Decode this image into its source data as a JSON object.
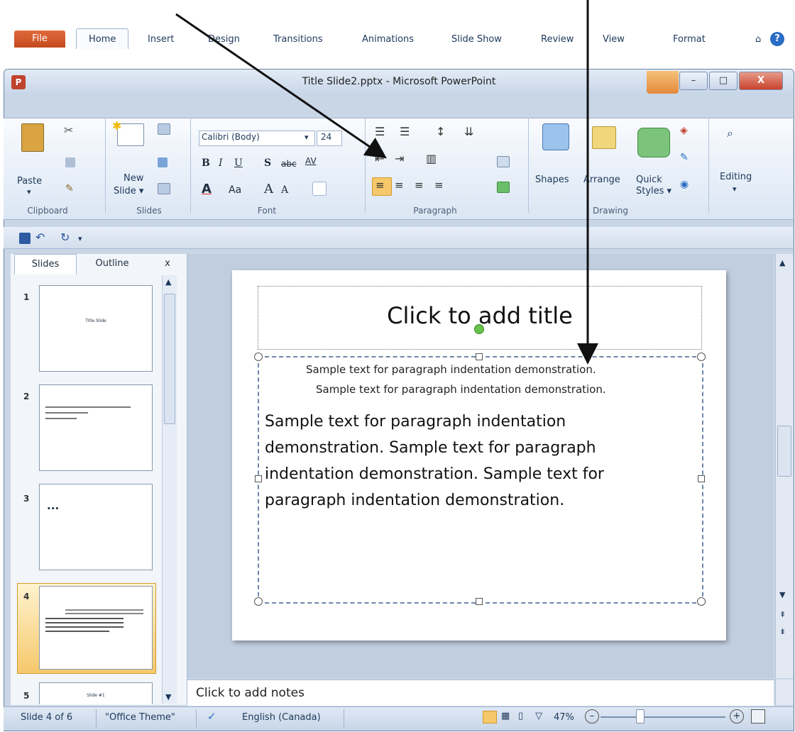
{
  "window": {
    "title": "Title Slide2.pptx - Microsoft PowerPoint",
    "app_icon": "P",
    "controls": {
      "minimize": "–",
      "maximize": "□",
      "close": "X"
    }
  },
  "tabs": [
    "File",
    "Home",
    "Insert",
    "Design",
    "Transitions",
    "Animations",
    "Slide Show",
    "Review",
    "View",
    "Format"
  ],
  "ribbon": {
    "clipboard": {
      "paste": "Paste",
      "label": "Clipboard"
    },
    "slides": {
      "new_slide": "New",
      "new_slide2": "Slide ▾",
      "label": "Slides"
    },
    "font": {
      "name": "Calibri (Body)",
      "size": "24",
      "bold": "B",
      "italic": "I",
      "underline": "U",
      "shadow": "S",
      "strike": "abc",
      "spacing": "AV",
      "font_color": "A",
      "case": "Aa",
      "grow": "A",
      "shrink": "A",
      "label": "Font"
    },
    "paragraph": {
      "label": "Paragraph"
    },
    "drawing": {
      "shapes": "Shapes",
      "arrange": "Arrange",
      "quick": "Quick",
      "styles": "Styles ▾",
      "label": "Drawing"
    },
    "editing": {
      "label": "Editing"
    }
  },
  "panel": {
    "tabs": [
      "Slides",
      "Outline"
    ],
    "close": "x",
    "thumbs": [
      {
        "num": "1",
        "text": "Title Slide"
      },
      {
        "num": "2",
        "text": ""
      },
      {
        "num": "3",
        "text": ""
      },
      {
        "num": "4",
        "text": ""
      },
      {
        "num": "5",
        "text": "Slide #1"
      }
    ]
  },
  "slide": {
    "title_placeholder": "Click to add title",
    "line1": "Sample text for paragraph indentation demonstration.",
    "line2": "Sample text for paragraph indentation demonstration.",
    "body": [
      "Sample text for paragraph indentation",
      "demonstration. Sample text for paragraph",
      "indentation demonstration. Sample text for",
      "paragraph indentation demonstration."
    ]
  },
  "notes_placeholder": "Click to add notes",
  "status": {
    "slide": "Slide 4 of 6",
    "theme": "\"Office Theme\"",
    "language": "English (Canada)",
    "zoom": "47%",
    "minus": "–",
    "plus": "+"
  },
  "colors": {
    "accent": "#c44a1c",
    "ribbon": "#dbe6f4",
    "selection": "#f5c86b"
  }
}
